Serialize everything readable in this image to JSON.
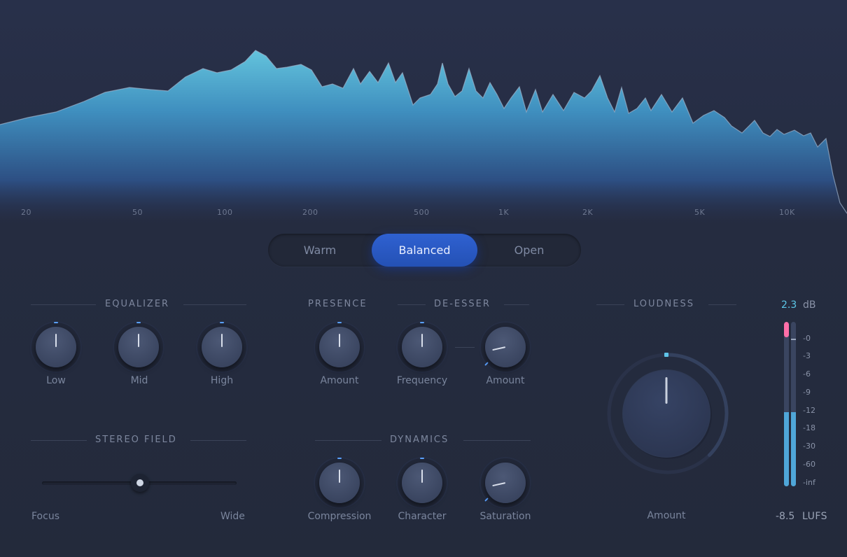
{
  "colors": {
    "accent": "#2f61d1",
    "spectrum": "#5bb8d6",
    "meter_fill": "#4fa6d8",
    "meter_peak": "#ff6fa8",
    "tick": "#5aa0ff"
  },
  "spectrum": {
    "freq_labels": [
      "20",
      "50",
      "100",
      "200",
      "500",
      "1K",
      "2K",
      "5K",
      "10K"
    ]
  },
  "modes": {
    "items": [
      "Warm",
      "Balanced",
      "Open"
    ],
    "selected": "Balanced"
  },
  "equalizer": {
    "title": "EQUALIZER",
    "knobs": [
      {
        "label": "Low",
        "value": 0.5
      },
      {
        "label": "Mid",
        "value": 0.5
      },
      {
        "label": "High",
        "value": 0.5
      }
    ]
  },
  "presence": {
    "title": "PRESENCE",
    "knob": {
      "label": "Amount",
      "value": 0.5
    }
  },
  "deesser": {
    "title": "DE-ESSER",
    "knobs": [
      {
        "label": "Frequency",
        "value": 0.5
      },
      {
        "label": "Amount",
        "value": 0.12
      }
    ]
  },
  "stereo": {
    "title": "STEREO FIELD",
    "left_label": "Focus",
    "right_label": "Wide",
    "value": 0.5
  },
  "dynamics": {
    "title": "DYNAMICS",
    "knobs": [
      {
        "label": "Compression",
        "value": 0.5
      },
      {
        "label": "Character",
        "value": 0.5
      },
      {
        "label": "Saturation",
        "value": 0.12
      }
    ]
  },
  "loudness": {
    "title": "LOUDNESS",
    "knob_label": "Amount",
    "value": 0.5
  },
  "meter": {
    "peak_value": "2.3",
    "peak_unit": "dB",
    "scale": [
      "-0",
      "-3",
      "-6",
      "-9",
      "-12",
      "-18",
      "-30",
      "-60",
      "-inf"
    ],
    "lufs_value": "-8.5",
    "lufs_unit": "LUFS",
    "left_level": 0.45,
    "right_level": 0.45
  }
}
